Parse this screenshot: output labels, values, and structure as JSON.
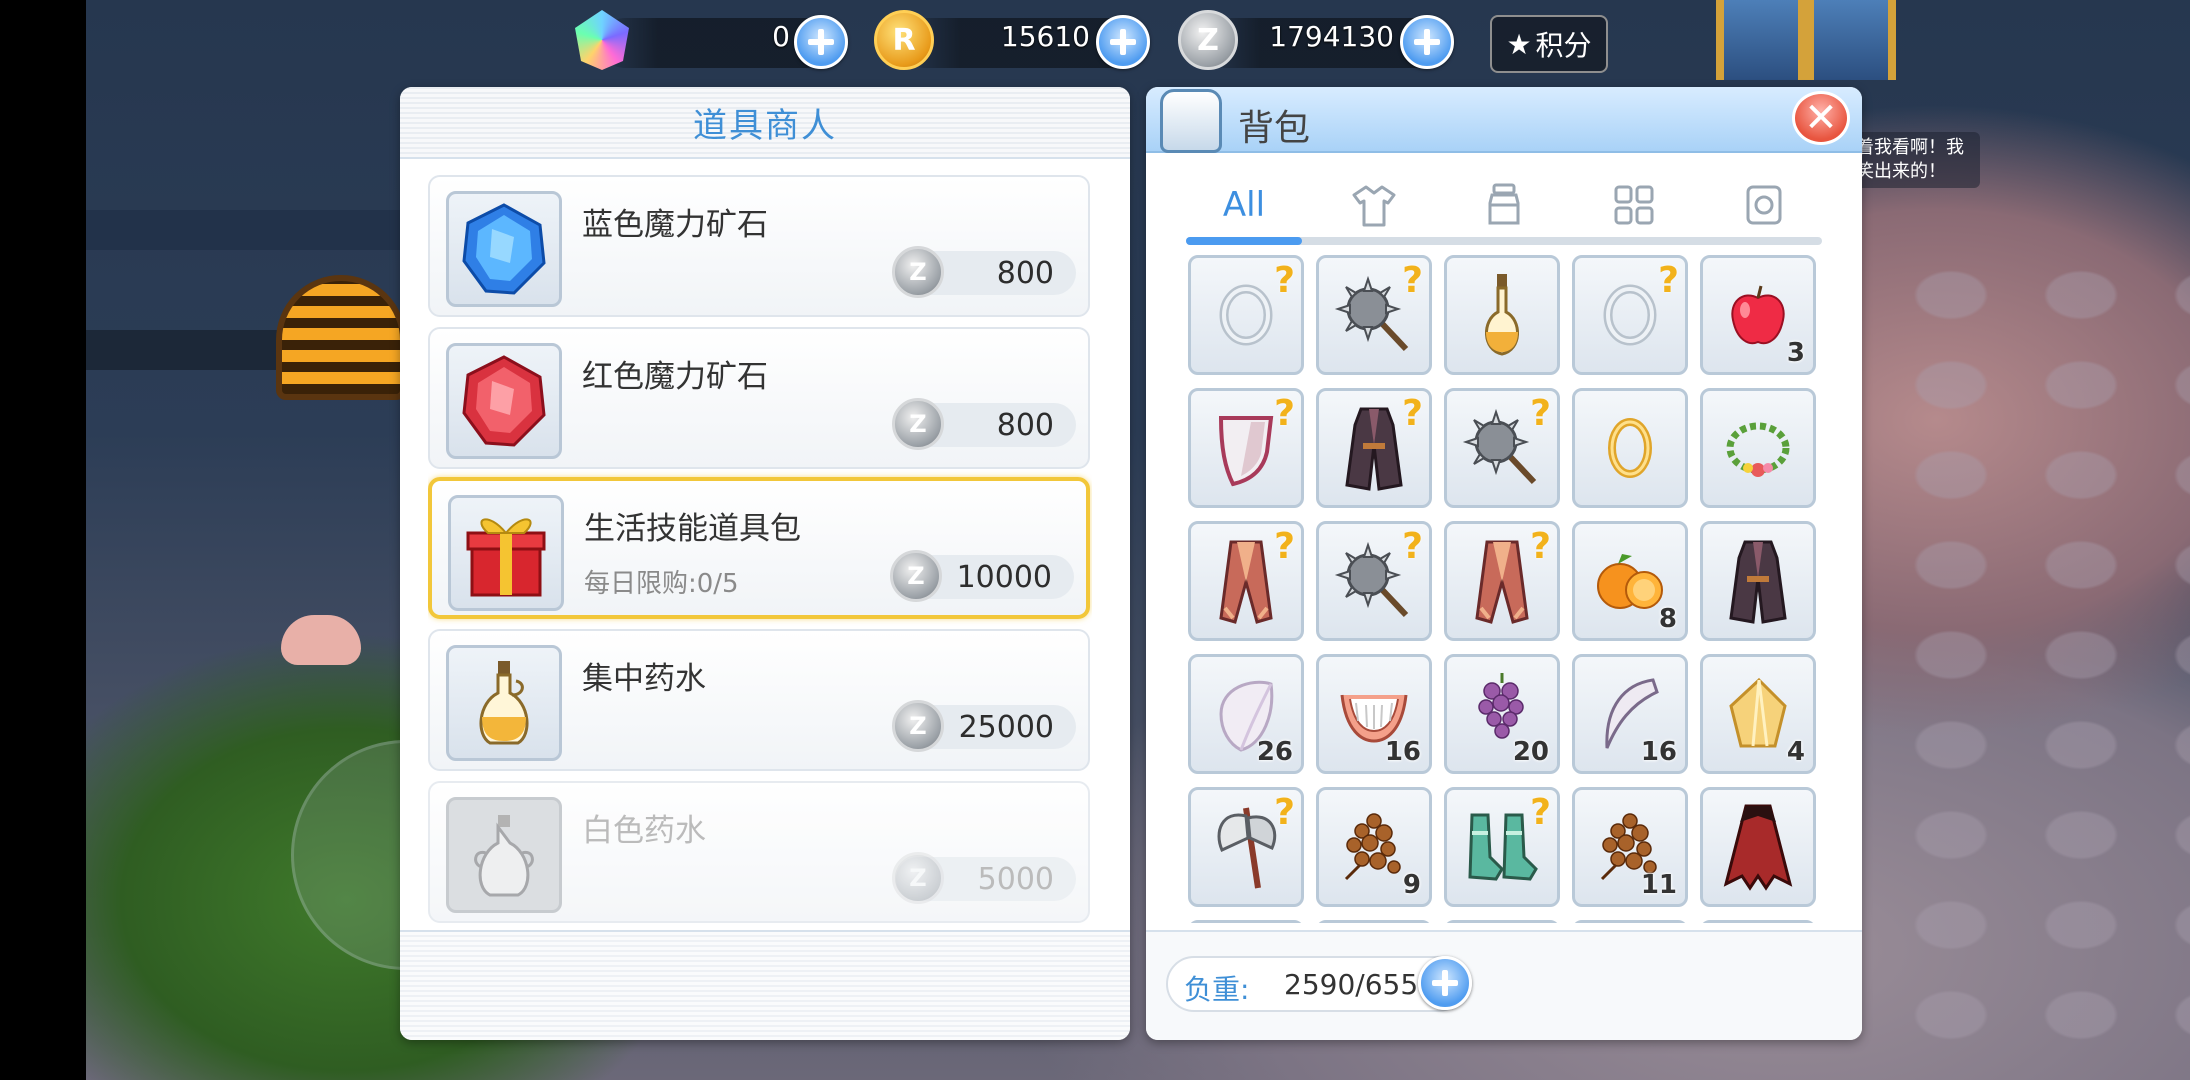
{
  "currencies": [
    {
      "icon": "rainbow-gem-icon",
      "value": "0"
    },
    {
      "icon": "gold-zeny-coin-icon",
      "letter": "R",
      "value": "15610"
    },
    {
      "icon": "silver-zeny-coin-icon",
      "letter": "Z",
      "value": "1794130"
    }
  ],
  "points_button": {
    "label": "积分",
    "icon": "star-icon"
  },
  "npc_speech": "着我看啊！我笑出来的！",
  "shop": {
    "title": "道具商人",
    "items": [
      {
        "name": "蓝色魔力矿石",
        "price": "800",
        "icon": "blue-gem-icon",
        "limit": ""
      },
      {
        "name": "红色魔力矿石",
        "price": "800",
        "icon": "red-gem-icon",
        "limit": ""
      },
      {
        "name": "生活技能道具包",
        "price": "10000",
        "icon": "gift-box-icon",
        "limit": "每日限购:0/5",
        "selected": true
      },
      {
        "name": "集中药水",
        "price": "25000",
        "icon": "potion-bottle-icon",
        "limit": ""
      },
      {
        "name": "白色药水",
        "price": "5000",
        "icon": "empty-bottle-icon",
        "limit": "",
        "disabled": true
      }
    ],
    "coin_letter": "Z"
  },
  "bag": {
    "title": "背包",
    "close_label": "✕",
    "tabs": [
      {
        "label": "All",
        "active": true
      },
      {
        "label": "",
        "icon": "clothing-icon"
      },
      {
        "label": "",
        "icon": "jar-icon"
      },
      {
        "label": "",
        "icon": "grid-icon"
      },
      {
        "label": "",
        "icon": "card-icon"
      }
    ],
    "slots": [
      {
        "icon": "ring-icon",
        "unidentified": true,
        "count": ""
      },
      {
        "icon": "spiked-mace-icon",
        "unidentified": true,
        "count": ""
      },
      {
        "icon": "potion-vial-icon",
        "unidentified": false,
        "count": ""
      },
      {
        "icon": "ring-icon",
        "unidentified": true,
        "count": ""
      },
      {
        "icon": "apple-icon",
        "unidentified": false,
        "count": "3"
      },
      {
        "icon": "shield-icon",
        "unidentified": true,
        "count": ""
      },
      {
        "icon": "robe-icon",
        "unidentified": true,
        "count": ""
      },
      {
        "icon": "spiked-mace-icon",
        "unidentified": true,
        "count": ""
      },
      {
        "icon": "gold-ring-icon",
        "unidentified": false,
        "count": ""
      },
      {
        "icon": "flower-wreath-icon",
        "unidentified": false,
        "count": ""
      },
      {
        "icon": "cape-icon",
        "unidentified": true,
        "count": ""
      },
      {
        "icon": "spiked-mace-icon",
        "unidentified": true,
        "count": ""
      },
      {
        "icon": "cape-icon",
        "unidentified": true,
        "count": ""
      },
      {
        "icon": "orange-icon",
        "unidentified": false,
        "count": "8"
      },
      {
        "icon": "robe-icon",
        "unidentified": false,
        "count": ""
      },
      {
        "icon": "shell-icon",
        "unidentified": false,
        "count": "26"
      },
      {
        "icon": "dentures-icon",
        "unidentified": false,
        "count": "16"
      },
      {
        "icon": "grapes-icon",
        "unidentified": false,
        "count": "20"
      },
      {
        "icon": "claw-icon",
        "unidentified": false,
        "count": "16"
      },
      {
        "icon": "yellow-shell-icon",
        "unidentified": false,
        "count": "4"
      },
      {
        "icon": "axe-icon",
        "unidentified": true,
        "count": ""
      },
      {
        "icon": "brown-berries-icon",
        "unidentified": false,
        "count": "9"
      },
      {
        "icon": "boots-icon",
        "unidentified": true,
        "count": ""
      },
      {
        "icon": "brown-berries-icon",
        "unidentified": false,
        "count": "11"
      },
      {
        "icon": "vampire-cape-icon",
        "unidentified": false,
        "count": ""
      }
    ],
    "weight_label": "负重:",
    "weight_value": "2590/6554"
  },
  "colors": {
    "accent_blue": "#3f8fd6",
    "selected_border": "#f2c73a",
    "unidentified_mark": "#f2b21b"
  }
}
